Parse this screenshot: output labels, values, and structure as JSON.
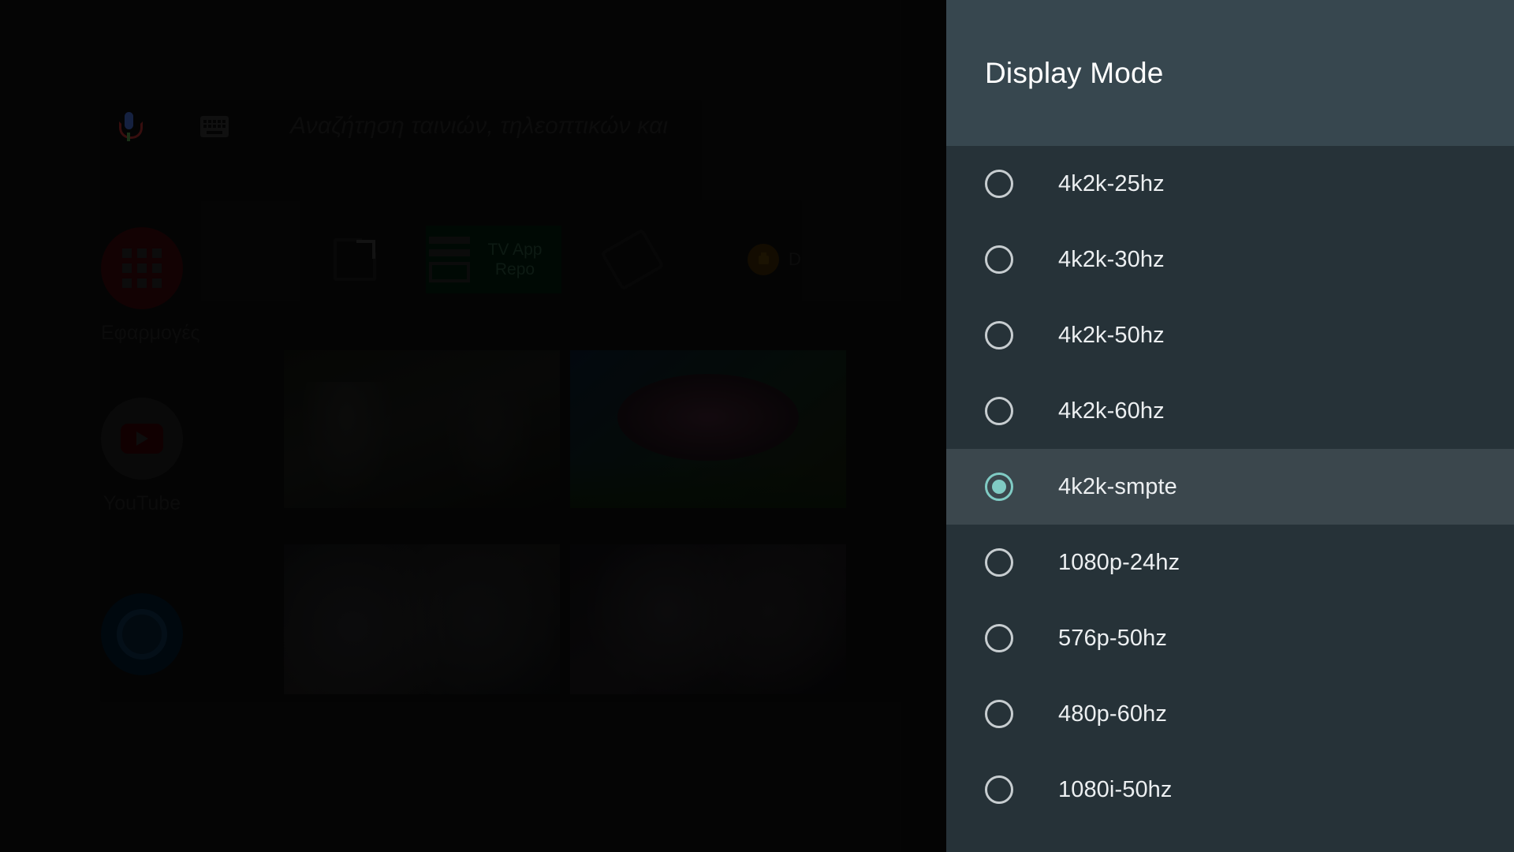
{
  "launcher": {
    "search": {
      "placeholder": "Αναζήτηση ταινιών, τηλεοπτικών και",
      "mic_icon": "microphone-icon",
      "keyboard_icon": "keyboard-icon"
    },
    "favorites": [
      {
        "label": "Εφαρμογές",
        "icon": "apps-grid-icon"
      },
      {
        "label": "YouTube",
        "icon": "youtube-icon"
      },
      {
        "label": "",
        "icon": "blue-circle-app-icon"
      }
    ],
    "shortcuts": [
      {
        "label": "",
        "icon": "external-link-icon"
      },
      {
        "label": "TV App Repo",
        "icon": "repo-list-icon"
      },
      {
        "label": "",
        "icon": "screen-rotate-icon"
      },
      {
        "label": "D",
        "icon": "lock-icon"
      }
    ],
    "thumbnails": [
      {
        "name": "thumbnail-1"
      },
      {
        "name": "thumbnail-2"
      },
      {
        "name": "thumbnail-3"
      },
      {
        "name": "thumbnail-4"
      }
    ]
  },
  "dialog": {
    "title": "Display Mode",
    "header_color": "#37474F",
    "list_color": "#263238",
    "selected_row_color": "#3B474D",
    "accent_color": "#80CBC4",
    "radio_outline_color": "#C7CDD0",
    "selected_value": "4k2k-smpte",
    "options": [
      {
        "label": "4k2k-25hz",
        "selected": false
      },
      {
        "label": "4k2k-30hz",
        "selected": false
      },
      {
        "label": "4k2k-50hz",
        "selected": false
      },
      {
        "label": "4k2k-60hz",
        "selected": false
      },
      {
        "label": "4k2k-smpte",
        "selected": true
      },
      {
        "label": "1080p-24hz",
        "selected": false
      },
      {
        "label": "576p-50hz",
        "selected": false
      },
      {
        "label": "480p-60hz",
        "selected": false
      },
      {
        "label": "1080i-50hz",
        "selected": false
      }
    ]
  }
}
